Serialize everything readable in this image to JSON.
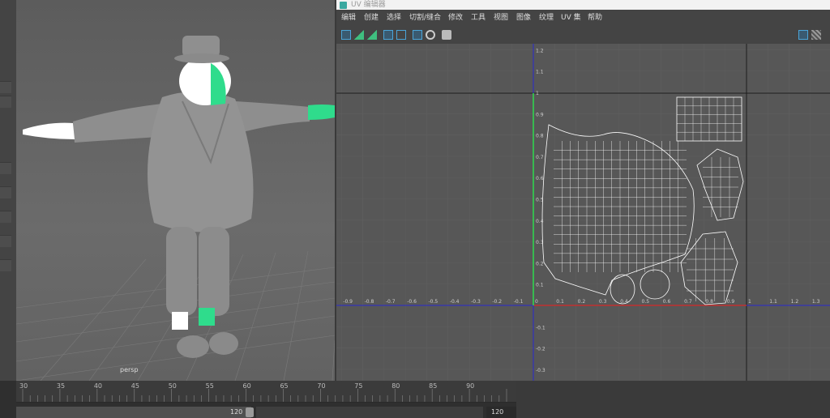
{
  "viewport": {
    "camera_label": "persp"
  },
  "uv_editor": {
    "window_title": "UV 编辑器",
    "menu": [
      "编辑",
      "创建",
      "选择",
      "切割/缝合",
      "修改",
      "工具",
      "视图",
      "图像",
      "纹理",
      "UV 集",
      "帮助"
    ],
    "x_ticks": [
      "-0.9",
      "-0.8",
      "-0.7",
      "-0.6",
      "-0.5",
      "-0.4",
      "-0.3",
      "-0.2",
      "-0.1",
      "0",
      "0.1",
      "0.2",
      "0.3",
      "0.4",
      "0.5",
      "0.6",
      "0.7",
      "0.8",
      "0.9",
      "1",
      "1.1",
      "1.2",
      "1.3",
      "1.4"
    ],
    "y_ticks": [
      "1.2",
      "1.1",
      "1",
      "0.9",
      "0.8",
      "0.7",
      "0.6",
      "0.5",
      "0.4",
      "0.3",
      "0.2",
      "0.1",
      "-0.1",
      "-0.2",
      "-0.3"
    ]
  },
  "timeline": {
    "ticks": [
      "30",
      "35",
      "40",
      "45",
      "50",
      "55",
      "60",
      "65",
      "70",
      "75",
      "80",
      "85",
      "90"
    ],
    "range_end": "120",
    "end_field": "120"
  },
  "colors": {
    "axis_u": "#c03030",
    "axis_v": "#2a2ad0",
    "uv_green": "#2fdc8c",
    "shell": "#ffffff"
  }
}
